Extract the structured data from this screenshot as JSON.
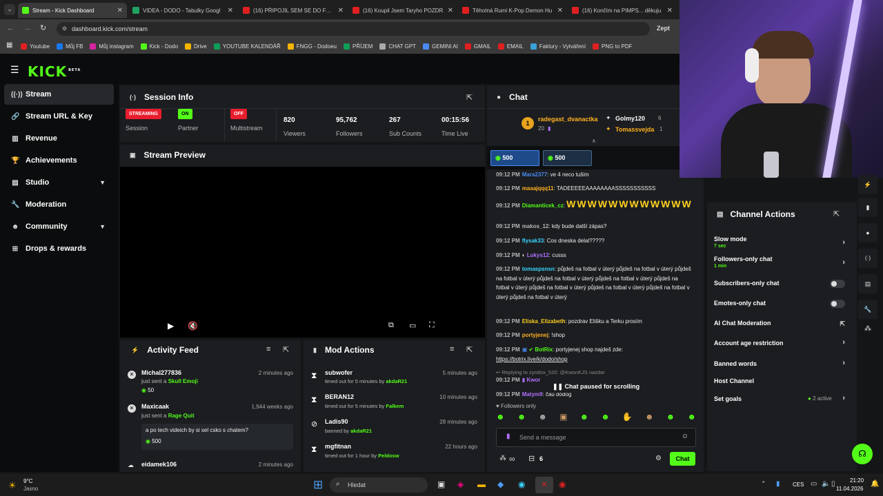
{
  "tabs": [
    {
      "label": "Stream - Kick Dashboard",
      "color": "#53fc18"
    },
    {
      "label": "VIDEA - DODO - Tabulky Googl",
      "color": "#1ea362"
    },
    {
      "label": "(16) PŘIPOJIL SEM SE DO FOTB",
      "color": "#e02020"
    },
    {
      "label": "(16) Koupil Jsem Taryho POZDR",
      "color": "#e02020"
    },
    {
      "label": "Těhotná Rumi K-Pop Demon Hu",
      "color": "#e02020"
    },
    {
      "label": "(16) Končím na PIMPS... děkuju",
      "color": "#e02020"
    }
  ],
  "address": "dashboard.kick.com/stream",
  "bookmarks": [
    {
      "label": "Youtube",
      "color": "#e02020"
    },
    {
      "label": "Můj FB",
      "color": "#1877f2"
    },
    {
      "label": "Můj instagram",
      "color": "#d6249f"
    },
    {
      "label": "Kick - Dodo",
      "color": "#53fc18"
    },
    {
      "label": "Drive",
      "color": "#f4b400"
    },
    {
      "label": "YOUTUBE KALENDÁŘ",
      "color": "#0f9d58"
    },
    {
      "label": "FNGG - Dodoeu",
      "color": "#f4b400"
    },
    {
      "label": "PŘÍJEM",
      "color": "#0f9d58"
    },
    {
      "label": "CHAT GPT",
      "color": "#aaaaaa"
    },
    {
      "label": "GEMINI AI",
      "color": "#4a8af4"
    },
    {
      "label": "GMAIL",
      "color": "#e02020"
    },
    {
      "label": "EMAIL",
      "color": "#e02020"
    },
    {
      "label": "Faktury - Vytváření",
      "color": "#3aa0d8"
    },
    {
      "label": "PNG to PDF",
      "color": "#e02020"
    }
  ],
  "extra_tab": "Zept",
  "logo": "KICK",
  "logo_tag": "BETA",
  "sidebar": [
    {
      "label": "Stream",
      "icon": "broadcast-icon"
    },
    {
      "label": "Stream URL & Key",
      "icon": "link-icon"
    },
    {
      "label": "Revenue",
      "icon": "revenue-icon"
    },
    {
      "label": "Achievements",
      "icon": "trophy-icon"
    },
    {
      "label": "Studio",
      "icon": "studio-icon"
    },
    {
      "label": "Moderation",
      "icon": "wrench-icon"
    },
    {
      "label": "Community",
      "icon": "community-icon"
    },
    {
      "label": "Drops & rewards",
      "icon": "gift-icon"
    }
  ],
  "session": {
    "title": "Session Info",
    "stats": [
      {
        "badge": "STREAMING",
        "badge_color": "#e81d2d",
        "label": "Session"
      },
      {
        "badge": "ON",
        "badge_color": "#53fc18",
        "label": "Partner"
      },
      {
        "badge": "OFF",
        "badge_color": "#e81d2d",
        "label": "Multistream"
      },
      {
        "value": "820",
        "label": "Viewers"
      },
      {
        "value": "95,762",
        "label": "Followers"
      },
      {
        "value": "267",
        "label": "Sub Counts"
      },
      {
        "value": "00:15:56",
        "label": "Time Live"
      }
    ]
  },
  "preview": {
    "title": "Stream Preview"
  },
  "activity": {
    "title": "Activity Feed",
    "items": [
      {
        "user": "Michal277836",
        "time": "2 minutes ago",
        "action": "just sent a",
        "gift": "Skull Emoji",
        "amount": "50"
      },
      {
        "user": "Maxicaak",
        "time": "1,944 weeks ago",
        "action": "just sent a",
        "gift": "Rage Quit",
        "message": "a po tech videich by si sel csko s chatem?",
        "amount": "500"
      },
      {
        "user": "eidamek106",
        "time": "2 minutes ago"
      }
    ]
  },
  "mod": {
    "title": "Mod Actions",
    "items": [
      {
        "user": "subwofer",
        "time": "5 minutes ago",
        "detail": "timed out for 5 minutes by",
        "by": "akdaR21"
      },
      {
        "user": "BERAN12",
        "time": "10 minutes ago",
        "detail": "timed out for 5 minutes by",
        "by": "Falkem"
      },
      {
        "user": "Ladis90",
        "time": "28 minutes ago",
        "detail": "banned by",
        "by": "akdaR21"
      },
      {
        "user": "mgfitnan",
        "time": "22 hours ago",
        "detail": "timed out for 1 hour by",
        "by": "Peldosw"
      }
    ]
  },
  "chat": {
    "title": "Chat",
    "top": [
      {
        "rank": "1",
        "user": "radegast_dvanactka",
        "amount": "20"
      },
      {
        "user": "Golmy120",
        "amount": "6"
      },
      {
        "user": "Tomassvejda",
        "amount": "1"
      }
    ],
    "pins": [
      "500",
      "500"
    ],
    "messages": [
      {
        "time": "09:12 PM",
        "user": "Mara2377",
        "color": "#4a8af4",
        "text": "ve 4 neco tušim"
      },
      {
        "time": "09:12 PM",
        "user": "maaajqqq11",
        "color": "#ffb020",
        "text": "TADEEEEEAAAAAAAASSSSSSSSSSS"
      },
      {
        "time": "09:12 PM",
        "user": "Diamanticek_cz",
        "color": "#53fc18",
        "text": "WWWWWWWWWWWW"
      },
      {
        "time": "09:12 PM",
        "user": "makos_12",
        "color": "#b8b8b8",
        "text": "kdy bude další zápas?"
      },
      {
        "time": "09:12 PM",
        "user": "flysak33",
        "color": "#3ad6ff",
        "text": "Cos dneska delal?????"
      },
      {
        "time": "09:12 PM",
        "user": "Lukys12",
        "color": "#b070ff",
        "text": "cusss"
      },
      {
        "time": "09:12 PM",
        "user": "tomaspsnsn",
        "color": "#3ad6ff",
        "text": "půjdeš na fotbal v úterý půjdeš na fotbal v úterý půjdeš na fotbal v úterý půjdeš na fotbal v úterý půjdeš na fotbal v úterý půjdeš na fotbal v úterý půjdeš na fotbal v úterý půjdeš na fotbal v úterý půjdeš na fotbal v úterý půjdeš na fotbal v úterý"
      },
      {
        "time": "09:12 PM",
        "user": "Eliska_Elizabeth",
        "color": "#ffd020",
        "text": "pozdrav Elišku a Terku prosím"
      },
      {
        "time": "09:12 PM",
        "user": "portyjenej",
        "color": "#ffb020",
        "text": "!shop"
      },
      {
        "time": "09:12 PM",
        "user": "BotRix",
        "color": "#53fc18",
        "text": "portyjenej shop najdeš zde:",
        "link": "https://botrix.live/k/dodo/shop"
      }
    ],
    "reply": "Replying to zyndox_520: @KwonKJS nazdar",
    "partial_user": "Kwor",
    "last": {
      "time": "09:12 PM",
      "user": "Matym9",
      "text": "čau dodog"
    },
    "paused": "Chat paused for scrolling",
    "followers_only": "Followers only",
    "input_placeholder": "Send a message",
    "count": "6",
    "send": "Chat"
  },
  "channel_actions": {
    "title": "Channel Actions",
    "items": [
      {
        "label": "Slow mode",
        "sub": "7 sec",
        "type": "arrow"
      },
      {
        "label": "Followers-only chat",
        "sub": "1 min",
        "type": "arrow"
      },
      {
        "label": "Subscribers-only chat",
        "type": "toggle"
      },
      {
        "label": "Emotes-only chat",
        "type": "toggle"
      },
      {
        "label": "AI Chat Moderation",
        "type": "external"
      },
      {
        "label": "Account age restriction",
        "type": "arrow"
      },
      {
        "label": "Banned words",
        "type": "arrow"
      },
      {
        "label": "Host Channel",
        "type": "none"
      },
      {
        "label": "Set goals",
        "sub_inline": "2 active",
        "type": "arrow"
      }
    ]
  },
  "taskbar": {
    "weather_temp": "9°C",
    "weather_desc": "Jasno",
    "search": "Hledat",
    "lang": "CES",
    "time": "21:20",
    "date": "11.04.2026"
  }
}
